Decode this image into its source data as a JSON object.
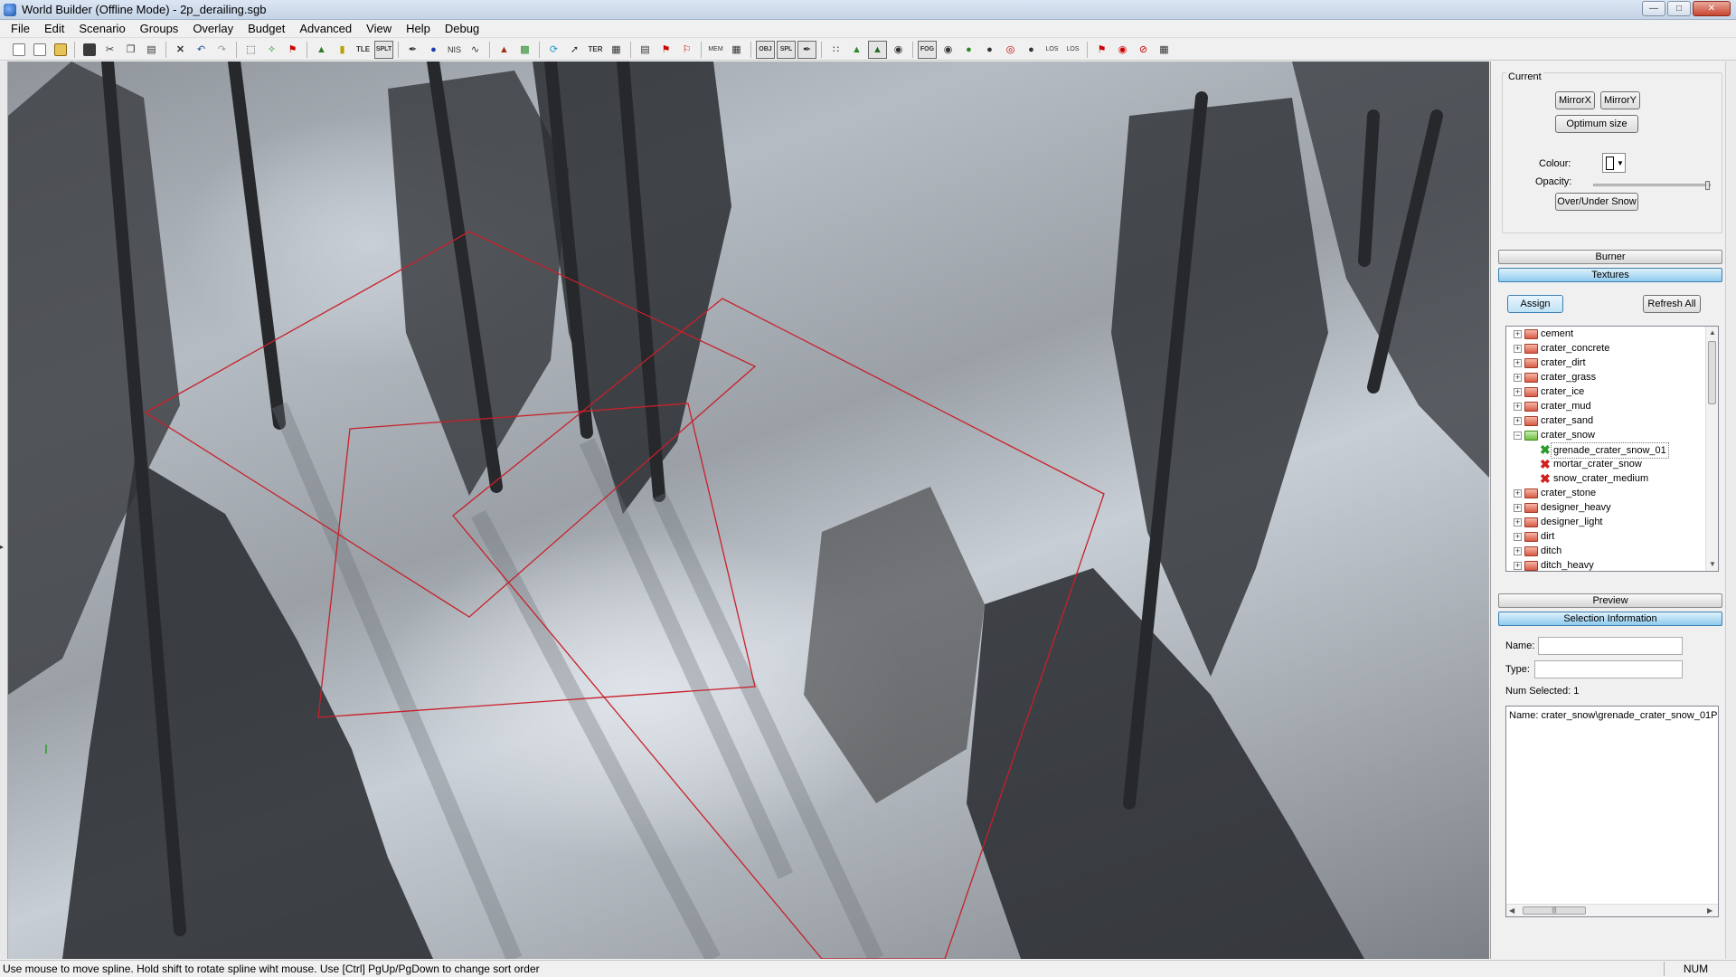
{
  "window": {
    "title": "World Builder (Offline Mode) - 2p_derailing.sgb"
  },
  "menu": [
    "File",
    "Edit",
    "Scenario",
    "Groups",
    "Overlay",
    "Budget",
    "Advanced",
    "View",
    "Help",
    "Debug"
  ],
  "toolbar": {
    "tle": "TLE",
    "splt": "SPLT",
    "nis": "NIS",
    "ter": "TER",
    "mem": "MEM",
    "obj": "OBJ",
    "spl": "SPL",
    "fog": "FOG",
    "los1": "LOS",
    "los2": "LOS"
  },
  "current": {
    "label": "Current",
    "mirrorx": "MirrorX",
    "mirrory": "MirrorY",
    "optimum": "Optimum size",
    "colour_label": "Colour:",
    "opacity_label": "Opacity:",
    "opacity_value": 0.95,
    "overunder": "Over/Under Snow"
  },
  "sections": {
    "burner": "Burner",
    "textures": "Textures",
    "preview": "Preview",
    "selection_info": "Selection Information"
  },
  "textures": {
    "assign": "Assign",
    "refresh": "Refresh All",
    "tree": [
      {
        "label": "cement",
        "kind": "folder",
        "state": "collapsed"
      },
      {
        "label": "crater_concrete",
        "kind": "folder",
        "state": "collapsed"
      },
      {
        "label": "crater_dirt",
        "kind": "folder",
        "state": "collapsed"
      },
      {
        "label": "crater_grass",
        "kind": "folder",
        "state": "collapsed"
      },
      {
        "label": "crater_ice",
        "kind": "folder",
        "state": "collapsed"
      },
      {
        "label": "crater_mud",
        "kind": "folder",
        "state": "collapsed"
      },
      {
        "label": "crater_sand",
        "kind": "folder",
        "state": "collapsed"
      },
      {
        "label": "crater_snow",
        "kind": "folder-open",
        "state": "expanded"
      },
      {
        "label": "grenade_crater_snow_01",
        "kind": "leaf-selected",
        "state": ""
      },
      {
        "label": "mortar_crater_snow",
        "kind": "leaf",
        "state": ""
      },
      {
        "label": "snow_crater_medium",
        "kind": "leaf",
        "state": ""
      },
      {
        "label": "crater_stone",
        "kind": "folder",
        "state": "collapsed"
      },
      {
        "label": "designer_heavy",
        "kind": "folder",
        "state": "collapsed"
      },
      {
        "label": "designer_light",
        "kind": "folder",
        "state": "collapsed"
      },
      {
        "label": "dirt",
        "kind": "folder",
        "state": "collapsed"
      },
      {
        "label": "ditch",
        "kind": "folder",
        "state": "collapsed"
      },
      {
        "label": "ditch_heavy",
        "kind": "folder",
        "state": "collapsed"
      }
    ]
  },
  "selection": {
    "name_label": "Name:",
    "name_value": "",
    "type_label": "Type:",
    "type_value": "",
    "num_selected": "Num Selected: 1",
    "details": "Name: crater_snow\\grenade_crater_snow_01P"
  },
  "status": {
    "message": "Use mouse to move spline. Hold shift to rotate spline wiht mouse. Use [Ctrl] PgUp/PgDown to change sort order",
    "num": "NUM"
  },
  "colors": {
    "spline": "#c8202a",
    "accent": "#3c7fb1"
  }
}
